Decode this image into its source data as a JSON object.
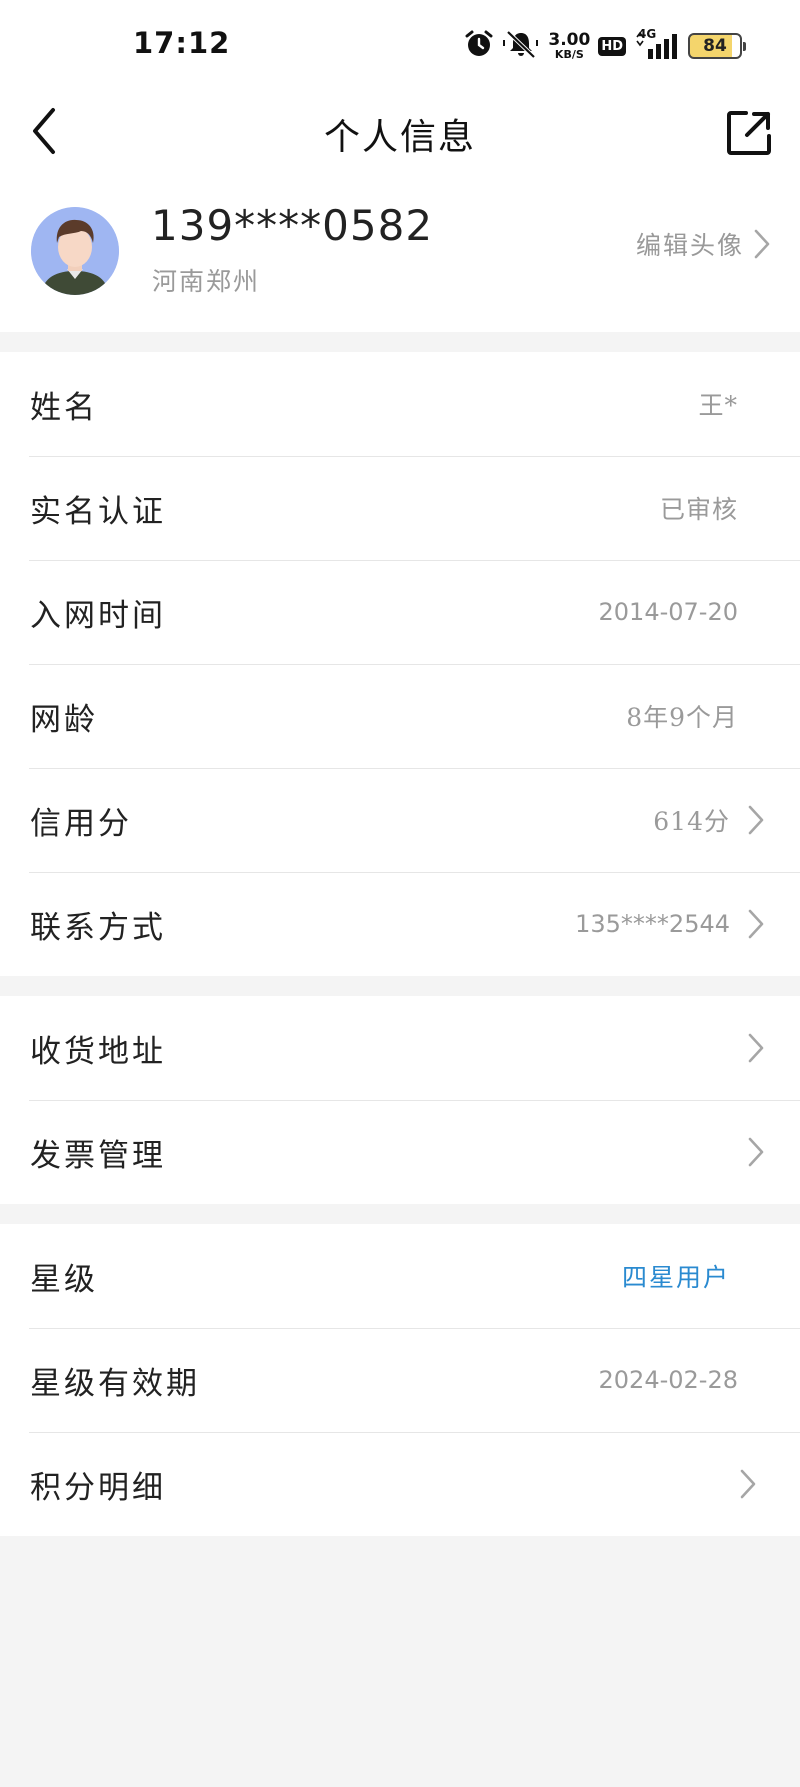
{
  "status_bar": {
    "time": "17:12",
    "speed_value": "3.00",
    "speed_unit": "KB/S",
    "hd": "HD",
    "network": "4G",
    "battery": "84",
    "icons": [
      "alarm-icon",
      "mute-icon",
      "signal-icon"
    ]
  },
  "nav": {
    "title": "个人信息",
    "icons": [
      "back-arrow-icon",
      "share-icon"
    ]
  },
  "profile": {
    "phone": "139****0582",
    "location": "河南郑州",
    "edit_avatar_label": "编辑头像"
  },
  "info_group": [
    {
      "label": "姓名",
      "value": "王*",
      "arrow": false
    },
    {
      "label": "实名认证",
      "value": "已审核",
      "arrow": false
    },
    {
      "label": "入网时间",
      "value": "2014-07-20",
      "arrow": false
    },
    {
      "label": "网龄",
      "value": "8年9个月",
      "arrow": false
    },
    {
      "label": "信用分",
      "value": "614分",
      "arrow": true
    },
    {
      "label": "联系方式",
      "value": "135****2544",
      "arrow": true
    }
  ],
  "address_group": [
    {
      "label": "收货地址",
      "arrow": true
    },
    {
      "label": "发票管理",
      "arrow": true
    }
  ],
  "star_group": [
    {
      "label": "星级",
      "value": "四星用户",
      "accent_color": "#2a8ad0",
      "arrow": false
    },
    {
      "label": "星级有效期",
      "value": "2024-02-28",
      "arrow": false
    },
    {
      "label": "积分明细",
      "arrow": true
    }
  ]
}
